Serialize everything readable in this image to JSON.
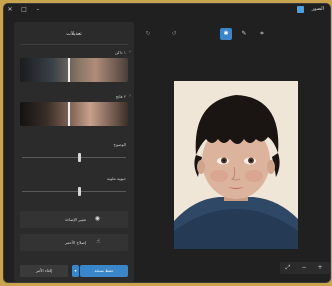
{
  "window": {
    "app_title": "الصور",
    "minimize_glyph": "–",
    "restore_glyph": "□",
    "close_glyph": "✕"
  },
  "panel": {
    "title": "تعديلات",
    "filter_1_label": "١ داكن",
    "filter_2_label": "٢ فاتح",
    "slider_1": {
      "label": "الوضوح",
      "value": 0.5
    },
    "slider_2": {
      "label": "حيوية ملونة",
      "value": 0.5
    },
    "action_1": {
      "label": "تغيير الإضاءة",
      "icon": "eye-icon"
    },
    "action_2": {
      "label": "إصلاح الأحمر",
      "icon": "hand-icon"
    },
    "save_copy_label": "حفظ نسخة",
    "cancel_label": "إلغاء الأمر"
  },
  "toolbar": {
    "redo_icon": "redo-icon",
    "undo_icon": "undo-icon",
    "active_tool_icon": "adjust-icon",
    "markup_icon": "pen-icon",
    "crop_icon": "crop-icon"
  },
  "zoom": {
    "fit_icon": "fit-icon",
    "zoom_out_glyph": "−",
    "zoom_in_glyph": "+"
  },
  "colors": {
    "accent": "#3a86c8",
    "panel_bg": "#2b2b2b",
    "canvas_bg": "#202020"
  }
}
